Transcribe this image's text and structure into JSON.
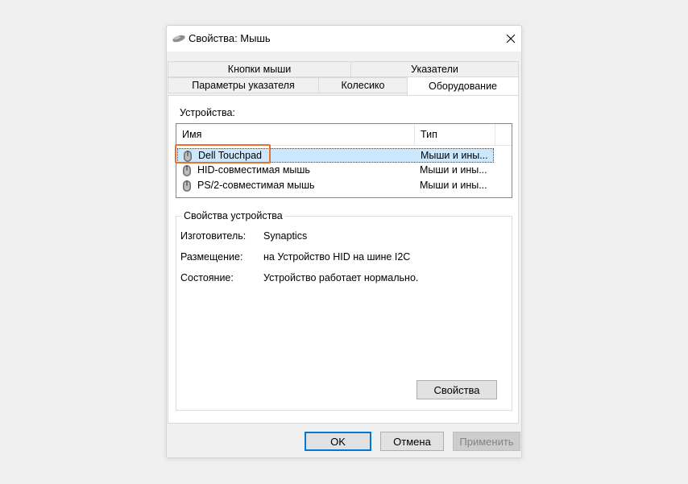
{
  "window": {
    "title": "Свойства: Мышь"
  },
  "tabs": {
    "row1": [
      {
        "label": "Кнопки мыши"
      },
      {
        "label": "Указатели"
      }
    ],
    "row2": [
      {
        "label": "Параметры указателя"
      },
      {
        "label": "Колесико"
      },
      {
        "label": "Оборудование",
        "active": true
      }
    ]
  },
  "devices": {
    "label": "Устройства:",
    "columns": [
      "Имя",
      "Тип"
    ],
    "rows": [
      {
        "name": "Dell Touchpad",
        "type": "Мыши и ины...",
        "selected": true
      },
      {
        "name": "HID-совместимая мышь",
        "type": "Мыши и ины..."
      },
      {
        "name": "PS/2-совместимая мышь",
        "type": "Мыши и ины..."
      }
    ]
  },
  "device_properties": {
    "legend": "Свойства устройства",
    "manufacturer_label": "Изготовитель:",
    "manufacturer_value": "Synaptics",
    "location_label": "Размещение:",
    "location_value": "на Устройство HID на шине I2C",
    "status_label": "Состояние:",
    "status_value": "Устройство работает нормально.",
    "properties_button": "Свойства"
  },
  "footer": {
    "ok_label": "OK",
    "cancel_label": "Отмена",
    "apply_label": "Применить"
  },
  "colors": {
    "selection": "#cce8ff",
    "highlight_box": "#e8702a",
    "primary_border": "#0078d7"
  },
  "icons": {
    "title": "mouse-icon",
    "close": "close-icon",
    "device": "mouse-device-icon"
  }
}
